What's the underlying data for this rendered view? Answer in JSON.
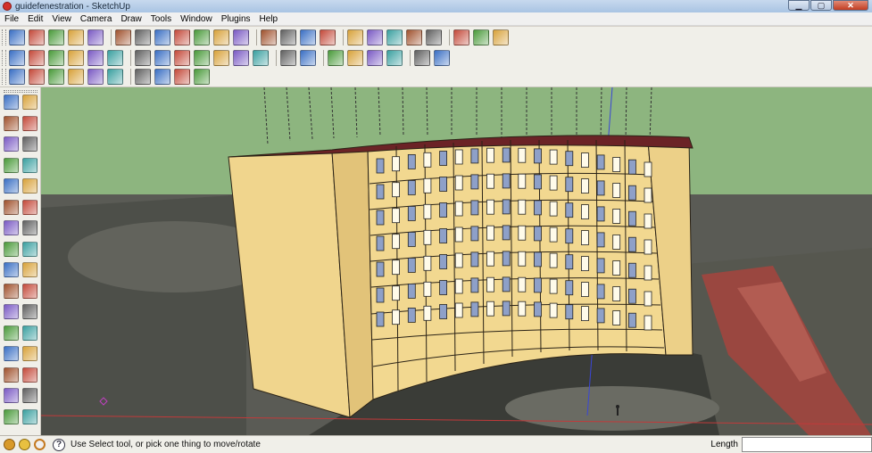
{
  "window": {
    "title": "guidefenestration - SketchUp",
    "buttons": {
      "minimize": "▁",
      "maximize": "▢",
      "close": "✕"
    }
  },
  "menu": [
    "File",
    "Edit",
    "View",
    "Camera",
    "Draw",
    "Tools",
    "Window",
    "Plugins",
    "Help"
  ],
  "toolbar_icons": {
    "row1": [
      "select-icon",
      "pencil-icon",
      "rectangle-icon",
      "circle-icon",
      "arc-icon",
      "sep",
      "eraser-icon",
      "paint-bucket-icon",
      "tape-measure-icon",
      "push-pull-icon",
      "move-icon",
      "rotate-icon",
      "follow-me-icon",
      "sep",
      "orbit-icon",
      "pan-icon",
      "zoom-icon",
      "zoom-extents-icon",
      "sep",
      "walk-icon",
      "section-icon",
      "component-icon",
      "position-camera-icon",
      "look-around-icon",
      "sep",
      "components-icon",
      "materials-icon",
      "shadow-icon"
    ],
    "row2": [
      "add-location-icon",
      "photo-textures-icon",
      "save-icon",
      "print-icon",
      "google-earth-icon",
      "warehouse-icon",
      "sep",
      "sandbox-from-contours-icon",
      "sandbox-scratch-icon",
      "smoove-icon",
      "stamp-icon",
      "drape-icon",
      "add-detail-icon",
      "flip-edge-icon",
      "sep",
      "get-models-icon",
      "share-model-icon",
      "sep",
      "dynamic-components-icon",
      "interact-icon",
      "options-icon",
      "attributes-icon",
      "sep",
      "layers-icon",
      "instructor-icon"
    ],
    "row3": [
      "iso-view-icon",
      "top-view-icon",
      "front-view-icon",
      "right-view-icon",
      "back-view-icon",
      "left-view-icon",
      "sep",
      "xray-icon",
      "wireframe-icon",
      "shaded-icon",
      "textured-icon"
    ]
  },
  "colors": {
    "sky": "#8db57f",
    "building_wall": "#f0d58d",
    "building_side": "#e2c379",
    "roof": "#6b2326",
    "window_glass": "#8ea0c8",
    "axis_red": "#c23a3a",
    "axis_blue": "#3a46d6"
  },
  "status": {
    "hint": "Use Select tool, or pick one thing to move/rotate",
    "hint_icon": "?",
    "vcb_label": "Length",
    "vcb_value": ""
  }
}
